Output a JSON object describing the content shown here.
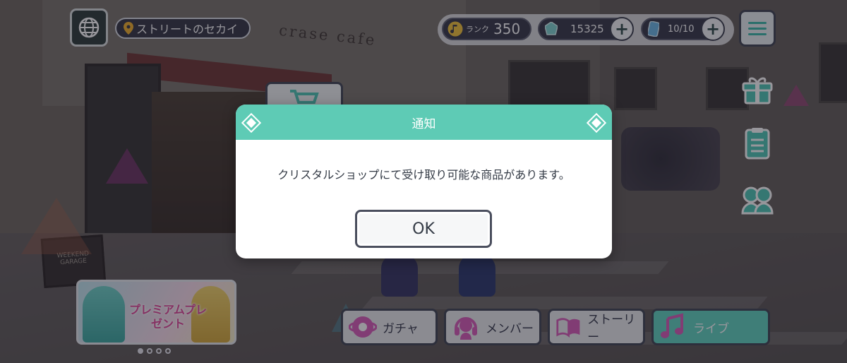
{
  "location": {
    "name": "ストリートのセカイ"
  },
  "resources": {
    "rank_label": "ランク",
    "rank_value": "350",
    "crystals": "15325",
    "energy": "10/10"
  },
  "scene": {
    "cafe_sign": "crase cafe",
    "weekend_sign": "WEEKEND GARAGE"
  },
  "banner": {
    "text": "プレミアムプレゼント",
    "page_count": 4,
    "active_page": 1
  },
  "nav": {
    "gacha": "ガチャ",
    "member": "メンバー",
    "story": "ストーリー",
    "live": "ライブ"
  },
  "dialog": {
    "title": "通知",
    "message": "クリスタルショップにて受け取り可能な商品があります。",
    "ok_label": "OK"
  },
  "colors": {
    "accent": "#5ecbb5",
    "hud_dark": "#353848",
    "border": "#3f4452"
  },
  "icons": [
    "globe-icon",
    "location-pin-icon",
    "music-note-icon",
    "crystal-icon",
    "energy-icon",
    "plus-icon",
    "menu-icon",
    "gift-icon",
    "clipboard-icon",
    "friends-icon",
    "shop-cart-icon",
    "gacha-icon",
    "member-icon",
    "story-book-icon",
    "live-music-icon",
    "diamond-icon"
  ]
}
